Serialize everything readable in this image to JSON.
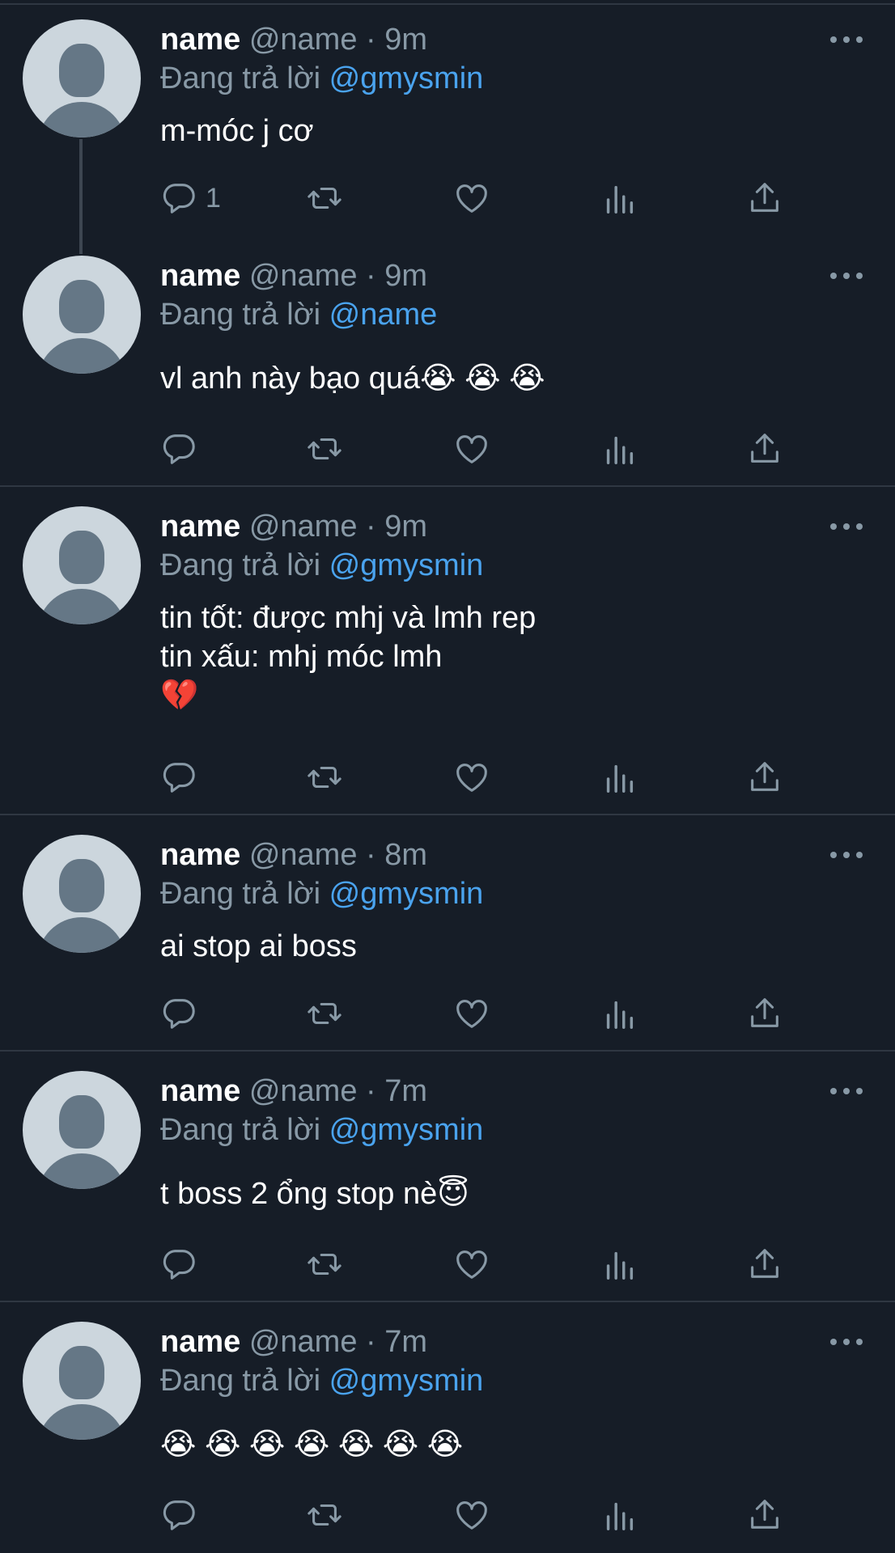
{
  "tweets": [
    {
      "display_name": "name",
      "handle": "@name",
      "separator": "·",
      "time": "9m",
      "reply_prefix": "Đang trả lời",
      "reply_to": "@gmysmin",
      "text": "m-móc j cơ",
      "reply_count": "1"
    },
    {
      "display_name": "name",
      "handle": "@name",
      "separator": "·",
      "time": "9m",
      "reply_prefix": "Đang trả lời",
      "reply_to": "@name",
      "text": "vl anh này bạo quá😭 😭 😭",
      "reply_count": ""
    },
    {
      "display_name": "name",
      "handle": "@name",
      "separator": "·",
      "time": "9m",
      "reply_prefix": "Đang trả lời",
      "reply_to": "@gmysmin",
      "text": "tin tốt: được mhj và lmh rep\ntin xấu: mhj móc lmh\n💔",
      "reply_count": ""
    },
    {
      "display_name": "name",
      "handle": "@name",
      "separator": "·",
      "time": "8m",
      "reply_prefix": "Đang trả lời",
      "reply_to": "@gmysmin",
      "text": "ai stop ai boss",
      "reply_count": ""
    },
    {
      "display_name": "name",
      "handle": "@name",
      "separator": "·",
      "time": "7m",
      "reply_prefix": "Đang trả lời",
      "reply_to": "@gmysmin",
      "text": "t boss 2 ổng stop nè😇",
      "reply_count": ""
    },
    {
      "display_name": "name",
      "handle": "@name",
      "separator": "·",
      "time": "7m",
      "reply_prefix": "Đang trả lời",
      "reply_to": "@gmysmin",
      "text": "😭 😭 😭 😭 😭 😭 😭",
      "reply_count": ""
    }
  ],
  "icons": {
    "reply": "reply-icon",
    "retweet": "retweet-icon",
    "like": "heart-icon",
    "analytics": "analytics-icon",
    "share": "share-icon",
    "more": "more-icon",
    "avatar": "default-avatar"
  },
  "colors": {
    "background": "#161d27",
    "text": "#ffffff",
    "muted": "#8899a6",
    "mention": "#4aa3ee",
    "divider": "#2f3742"
  }
}
